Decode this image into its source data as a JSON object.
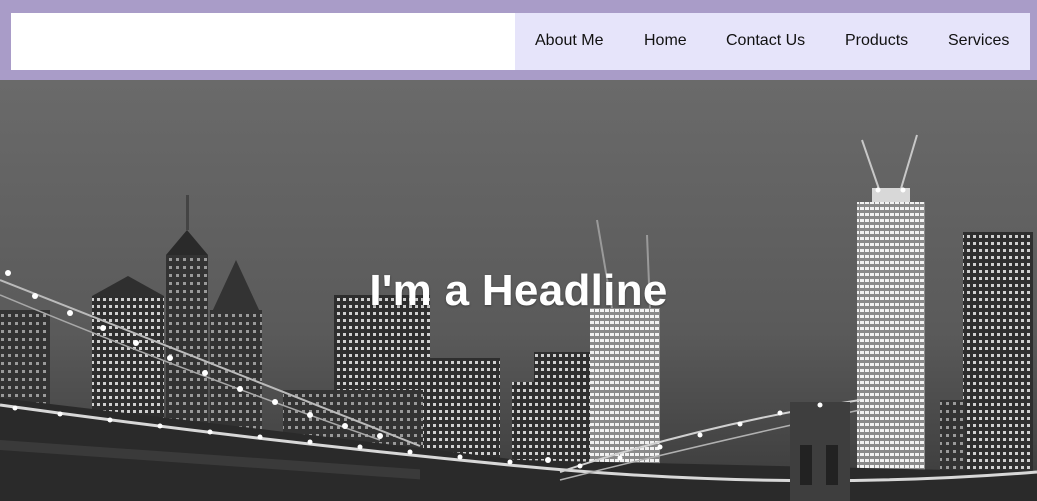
{
  "nav": {
    "items": [
      {
        "label": "About Me"
      },
      {
        "label": "Home"
      },
      {
        "label": "Contact Us"
      },
      {
        "label": "Products"
      },
      {
        "label": "Services"
      }
    ]
  },
  "hero": {
    "headline": "I'm a Headline",
    "image": "city-skyline-bridge-night"
  },
  "colors": {
    "header_border": "#a99cc8",
    "nav_background": "#e6e4fa",
    "logo_background": "#ffffff"
  }
}
